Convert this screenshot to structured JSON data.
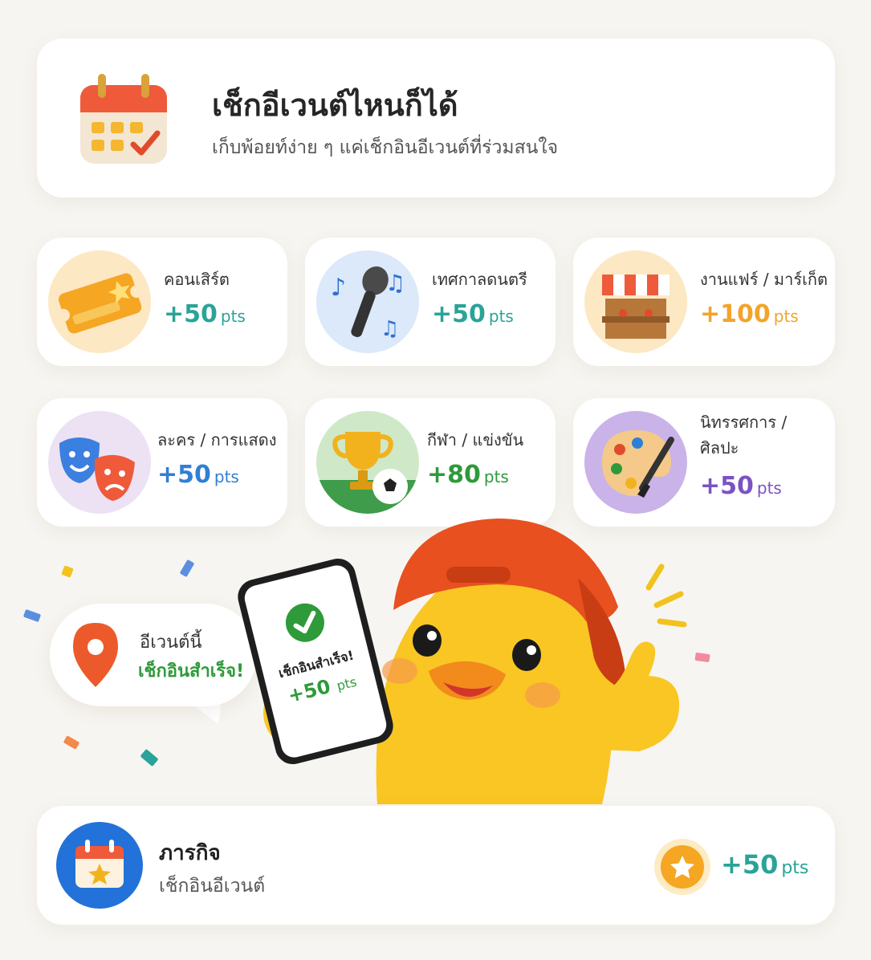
{
  "header": {
    "title": "เช็กอีเวนต์ไหนก็ได้",
    "subtitle": "เก็บพ้อยท์ง่าย ๆ แค่เช็กอินอีเวนต์ที่ร่วมสนใจ",
    "icon": "calendar-check-icon"
  },
  "events": [
    {
      "name": "คอนเสิร์ต",
      "points": "+50",
      "unit": "pts",
      "color": "#2aa399",
      "icon": "ticket-icon"
    },
    {
      "name": "เทศกาลดนตรี",
      "points": "+50",
      "unit": "pts",
      "color": "#2aa399",
      "icon": "microphone-icon"
    },
    {
      "name": "งานแฟร์ / มาร์เก็ต",
      "points": "+100",
      "unit": "pts",
      "color": "#f2a42a",
      "icon": "market-stall-icon"
    },
    {
      "name": "ละคร / การแสดง",
      "points": "+50",
      "unit": "pts",
      "color": "#2f7fd6",
      "icon": "theater-masks-icon"
    },
    {
      "name": "กีฬา / แข่งขัน",
      "points": "+80",
      "unit": "pts",
      "color": "#2e9a3a",
      "icon": "trophy-ball-icon"
    },
    {
      "name": "นิทรรศการ / ศิลปะ",
      "points": "+50",
      "unit": "pts",
      "color": "#7b52c4",
      "icon": "art-palette-icon"
    }
  ],
  "bubble": {
    "line1": "อีเวนต์นี้",
    "line2": "เช็กอินสำเร็จ!",
    "icon": "location-pin-icon"
  },
  "phone": {
    "status": "เช็กอินสำเร็จ!",
    "points": "+50",
    "unit": "pts",
    "icon": "check-circle-icon"
  },
  "mission": {
    "title": "ภารกิจ",
    "subtitle": "เช็กอินอีเวนต์",
    "points": "+50",
    "unit": "pts",
    "icon": "calendar-star-icon",
    "coin_icon": "star-coin-icon"
  }
}
